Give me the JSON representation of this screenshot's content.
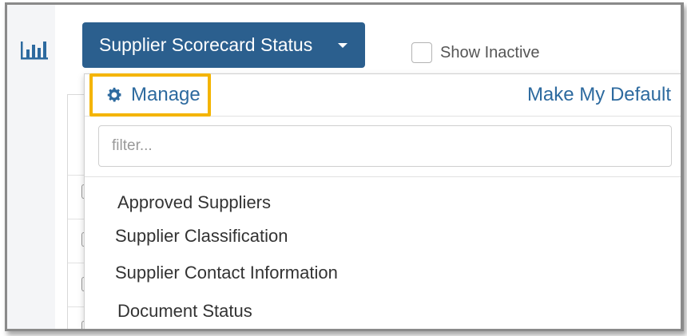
{
  "toolbar": {
    "report_button_label": "Supplier Scorecard Status",
    "show_inactive_label": "Show Inactive",
    "show_inactive_checked": false
  },
  "dropdown": {
    "manage_label": "Manage",
    "make_default_label": "Make My Default",
    "filter_placeholder": "filter...",
    "filter_value": "",
    "items": [
      "Approved Suppliers",
      "Supplier Classification",
      "Supplier Contact Information",
      "Document Status"
    ]
  },
  "icons": {
    "sidebar": "bar-chart-icon",
    "manage": "gear-icon",
    "button": "caret-down-icon"
  },
  "colors": {
    "primary_button": "#2b5f8e",
    "link": "#2d6a9f",
    "highlight": "#f4b400"
  }
}
